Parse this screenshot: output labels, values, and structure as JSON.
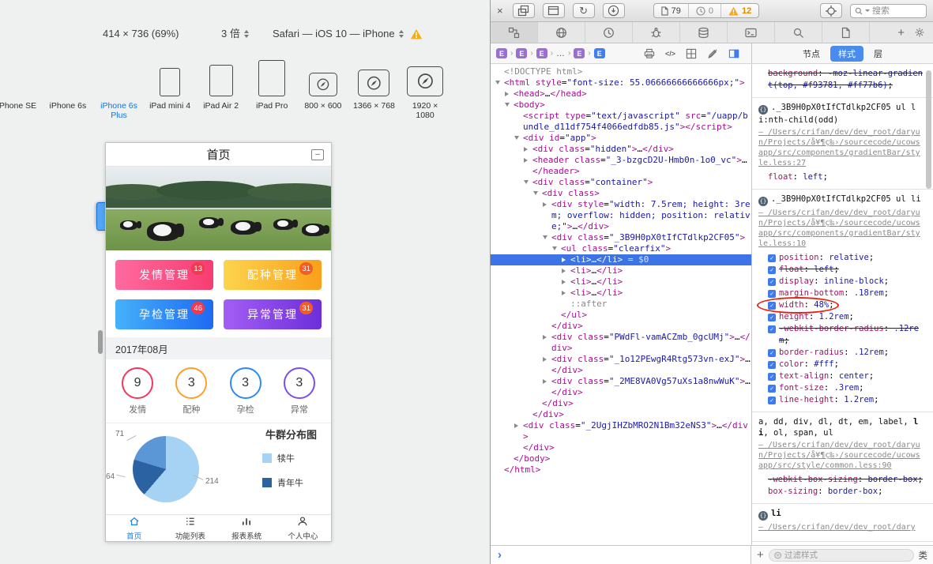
{
  "simulator": {
    "resolution": "414 × 736 (69%)",
    "scale": "3 倍",
    "browser": "Safari — iOS 10 — iPhone",
    "devices": [
      {
        "label": "iPhone SE",
        "type": "phone",
        "size": "s",
        "selected": false
      },
      {
        "label": "iPhone 6s",
        "type": "phone",
        "size": "m",
        "selected": false
      },
      {
        "label": "iPhone 6s Plus",
        "type": "phone",
        "size": "l",
        "selected": true
      },
      {
        "label": "iPad mini 4",
        "type": "tablet",
        "size": "s",
        "selected": false
      },
      {
        "label": "iPad Air 2",
        "type": "tablet",
        "size": "m",
        "selected": false
      },
      {
        "label": "iPad Pro",
        "type": "tablet",
        "size": "l",
        "selected": false
      },
      {
        "label": "800 × 600",
        "type": "browser",
        "size": "s",
        "selected": false
      },
      {
        "label": "1366 × 768",
        "type": "browser",
        "size": "m",
        "selected": false
      },
      {
        "label": "1920 × 1080",
        "type": "browser",
        "size": "l",
        "selected": false
      }
    ]
  },
  "phone": {
    "title": "首页",
    "collapse_glyph": "–",
    "buttons": [
      {
        "label": "发情管理",
        "badge": "13",
        "from": "#ff6a9e",
        "to": "#f73d72",
        "badge_color": "#f03a4f"
      },
      {
        "label": "配种管理",
        "badge": "31",
        "from": "#fdd44d",
        "to": "#f9a01b",
        "badge_color": "#f55b23"
      },
      {
        "label": "孕检管理",
        "badge": "46",
        "from": "#45b1fa",
        "to": "#1e6af2",
        "badge_color": "#f03a4f"
      },
      {
        "label": "异常管理",
        "badge": "31",
        "from": "#a35ef5",
        "to": "#6c2fd9",
        "badge_color": "#f55b23"
      }
    ],
    "month": "2017年08月",
    "stats": [
      {
        "value": "9",
        "label": "发情",
        "color": "#f5365c"
      },
      {
        "value": "3",
        "label": "配种",
        "color": "#fba02b"
      },
      {
        "value": "3",
        "label": "孕检",
        "color": "#2b8af5"
      },
      {
        "value": "3",
        "label": "异常",
        "color": "#7b4df0"
      }
    ],
    "chart_data": {
      "type": "pie",
      "title": "牛群分布图",
      "slices": [
        {
          "label": "犊牛",
          "value": 214,
          "color": "#a6d2f3"
        },
        {
          "label": "青年牛",
          "value": 64,
          "color": "#2a62a2"
        },
        {
          "label": "",
          "value": 71,
          "color": "#5b97d6"
        }
      ],
      "legend": [
        {
          "label": "犊牛",
          "color": "#a6d2f3"
        },
        {
          "label": "青年牛",
          "color": "#2a62a2"
        }
      ]
    },
    "tabbar": [
      {
        "label": "首页",
        "icon": "home",
        "active": true
      },
      {
        "label": "功能列表",
        "icon": "list",
        "active": false
      },
      {
        "label": "报表系统",
        "icon": "chart",
        "active": false
      },
      {
        "label": "个人中心",
        "icon": "user",
        "active": false
      }
    ]
  },
  "inspector": {
    "toolbar": {
      "close_glyph": "×",
      "reload_glyph": "↻",
      "doc_count": "79",
      "time_count": "0",
      "warn_count": "12",
      "search_placeholder": "搜索"
    },
    "breadcrumbs": [
      {
        "label": "E",
        "variant": "purple"
      },
      {
        "label": "E",
        "variant": "purple"
      },
      {
        "label": "E",
        "variant": "purple"
      },
      {
        "label": "…",
        "variant": "plain"
      },
      {
        "label": "E",
        "variant": "purple"
      },
      {
        "label": "E",
        "variant": "blue"
      }
    ],
    "code_glyph": "</>",
    "selected_suffix": "= $0",
    "dom": [
      {
        "i": 0,
        "a": 0,
        "t": [
          [
            "g",
            "<!DOCTYPE html>"
          ]
        ]
      },
      {
        "i": 0,
        "a": 2,
        "t": [
          [
            "t",
            "<html "
          ],
          [
            "t",
            "style"
          ],
          [
            "p",
            "="
          ],
          [
            "v",
            "\"font-size: 55.06666666666666px;\""
          ],
          [
            "t",
            ">"
          ]
        ]
      },
      {
        "i": 1,
        "a": 1,
        "t": [
          [
            "t",
            "<head>"
          ],
          [
            "p",
            "…"
          ],
          [
            "t",
            "</head>"
          ]
        ]
      },
      {
        "i": 1,
        "a": 2,
        "t": [
          [
            "t",
            "<body>"
          ]
        ]
      },
      {
        "i": 2,
        "a": 0,
        "t": [
          [
            "t",
            "<script "
          ],
          [
            "t",
            "type"
          ],
          [
            "p",
            "="
          ],
          [
            "v",
            "\"text/javascript\""
          ],
          [
            "t",
            " src"
          ],
          [
            "p",
            "="
          ],
          [
            "v",
            "\"/uapp/bundle_d11df754f4066edfdb85.js\""
          ],
          [
            "t",
            "></script>"
          ]
        ]
      },
      {
        "i": 2,
        "a": 2,
        "t": [
          [
            "t",
            "<div "
          ],
          [
            "t",
            "id"
          ],
          [
            "p",
            "="
          ],
          [
            "v",
            "\"app\""
          ],
          [
            "t",
            ">"
          ]
        ]
      },
      {
        "i": 3,
        "a": 1,
        "t": [
          [
            "t",
            "<div "
          ],
          [
            "t",
            "class"
          ],
          [
            "p",
            "="
          ],
          [
            "v",
            "\"hidden\""
          ],
          [
            "t",
            ">"
          ],
          [
            "p",
            "…"
          ],
          [
            "t",
            "</div>"
          ]
        ]
      },
      {
        "i": 3,
        "a": 1,
        "t": [
          [
            "t",
            "<header "
          ],
          [
            "t",
            "class"
          ],
          [
            "p",
            "="
          ],
          [
            "v",
            "\"_3-bzgcD2U-Hmb0n-1o0_vc\""
          ],
          [
            "t",
            ">"
          ],
          [
            "p",
            "…"
          ],
          [
            "t",
            "</header>"
          ]
        ]
      },
      {
        "i": 3,
        "a": 2,
        "t": [
          [
            "t",
            "<div "
          ],
          [
            "t",
            "class"
          ],
          [
            "p",
            "="
          ],
          [
            "v",
            "\"container\""
          ],
          [
            "t",
            ">"
          ]
        ]
      },
      {
        "i": 4,
        "a": 2,
        "t": [
          [
            "t",
            "<div "
          ],
          [
            "t",
            "class"
          ],
          [
            "t",
            ">"
          ]
        ]
      },
      {
        "i": 5,
        "a": 1,
        "t": [
          [
            "t",
            "<div "
          ],
          [
            "t",
            "style"
          ],
          [
            "p",
            "="
          ],
          [
            "v",
            "\"width: 7.5rem; height: 3rem; overflow: hidden; position: relative;\""
          ],
          [
            "t",
            ">"
          ],
          [
            "p",
            "…"
          ],
          [
            "t",
            "</div>"
          ]
        ]
      },
      {
        "i": 5,
        "a": 2,
        "t": [
          [
            "t",
            "<div "
          ],
          [
            "t",
            "class"
          ],
          [
            "p",
            "="
          ],
          [
            "v",
            "\"_3B9H0pX0tIfCTdlkp2CF05\""
          ],
          [
            "t",
            ">"
          ]
        ]
      },
      {
        "i": 6,
        "a": 2,
        "t": [
          [
            "t",
            "<ul "
          ],
          [
            "t",
            "class"
          ],
          [
            "p",
            "="
          ],
          [
            "v",
            "\"clearfix\""
          ],
          [
            "t",
            ">"
          ]
        ]
      },
      {
        "i": 7,
        "a": 1,
        "s": 1,
        "t": [
          [
            "t",
            "<li>"
          ],
          [
            "p",
            "…"
          ],
          [
            "t",
            "</li>"
          ]
        ]
      },
      {
        "i": 7,
        "a": 1,
        "t": [
          [
            "t",
            "<li>"
          ],
          [
            "p",
            "…"
          ],
          [
            "t",
            "</li>"
          ]
        ]
      },
      {
        "i": 7,
        "a": 1,
        "t": [
          [
            "t",
            "<li>"
          ],
          [
            "p",
            "…"
          ],
          [
            "t",
            "</li>"
          ]
        ]
      },
      {
        "i": 7,
        "a": 1,
        "t": [
          [
            "t",
            "<li>"
          ],
          [
            "p",
            "…"
          ],
          [
            "t",
            "</li>"
          ]
        ]
      },
      {
        "i": 7,
        "a": 0,
        "t": [
          [
            "g",
            "::after"
          ]
        ]
      },
      {
        "i": 6,
        "a": 0,
        "t": [
          [
            "t",
            "</ul>"
          ]
        ]
      },
      {
        "i": 5,
        "a": 0,
        "t": [
          [
            "t",
            "</div>"
          ]
        ]
      },
      {
        "i": 5,
        "a": 1,
        "t": [
          [
            "t",
            "<div "
          ],
          [
            "t",
            "class"
          ],
          [
            "p",
            "="
          ],
          [
            "v",
            "\"PWdFl-vamACZmb_0gcUMj\""
          ],
          [
            "t",
            ">"
          ],
          [
            "p",
            "…"
          ],
          [
            "t",
            "</div>"
          ]
        ]
      },
      {
        "i": 5,
        "a": 1,
        "t": [
          [
            "t",
            "<div "
          ],
          [
            "t",
            "class"
          ],
          [
            "p",
            "="
          ],
          [
            "v",
            "\"_1o12PEwgR4Rtg573vn-exJ\""
          ],
          [
            "t",
            ">"
          ],
          [
            "p",
            "…"
          ],
          [
            "t",
            "</div>"
          ]
        ]
      },
      {
        "i": 5,
        "a": 1,
        "t": [
          [
            "t",
            "<div "
          ],
          [
            "t",
            "class"
          ],
          [
            "p",
            "="
          ],
          [
            "v",
            "\"_2ME8VA0Vg57uXs1a8nwWuK\""
          ],
          [
            "t",
            ">"
          ],
          [
            "p",
            "…"
          ],
          [
            "t",
            "</div>"
          ]
        ]
      },
      {
        "i": 4,
        "a": 0,
        "t": [
          [
            "t",
            "</div>"
          ]
        ]
      },
      {
        "i": 3,
        "a": 0,
        "t": [
          [
            "t",
            "</div>"
          ]
        ]
      },
      {
        "i": 2,
        "a": 1,
        "t": [
          [
            "t",
            "<div "
          ],
          [
            "t",
            "class"
          ],
          [
            "p",
            "="
          ],
          [
            "v",
            "\"_2UgjIHZbMRO2N1Bm32eNS3\""
          ],
          [
            "t",
            ">"
          ],
          [
            "p",
            "…"
          ],
          [
            "t",
            "</div>"
          ]
        ]
      },
      {
        "i": 2,
        "a": 0,
        "t": [
          [
            "t",
            "</div>"
          ]
        ]
      },
      {
        "i": 1,
        "a": 0,
        "t": [
          [
            "t",
            "</body>"
          ]
        ]
      },
      {
        "i": 0,
        "a": 0,
        "t": [
          [
            "t",
            "</html>"
          ]
        ]
      }
    ],
    "styles": {
      "tabs": [
        "节点",
        "样式",
        "层"
      ],
      "active_tab": "样式",
      "filter_placeholder": "过滤样式",
      "class_button": "类",
      "rules": [
        {
          "icon": false,
          "props": [
            {
              "name": "background",
              "value": "-moz-linear-gradient(top, #f93781, #ff77b6)",
              "struck": true
            }
          ]
        },
        {
          "icon": true,
          "selector_parts": [
            [
              "",
              "._3B9H0pX0tIfCTdlkp2CF05 ul li:nth-child(odd)"
            ]
          ],
          "source": "— /Users/crifan/dev/dev_root/daryun/Projects/å¥¶ç‰›/sourcecode/ucowsapp/src/components/gradientBar/style.less:27",
          "props": [
            {
              "name": "float",
              "value": "left"
            }
          ]
        },
        {
          "icon": true,
          "selector_parts": [
            [
              "",
              "._3B9H0pX0tIfCTdlkp2CF05 ul li"
            ]
          ],
          "source": "— /Users/crifan/dev/dev_root/daryun/Projects/å¥¶ç‰›/sourcecode/ucowsapp/src/components/gradientBar/style.less:10",
          "props": [
            {
              "name": "position",
              "value": "relative",
              "check": true
            },
            {
              "name": "float",
              "value": "left",
              "check": true,
              "struck": true
            },
            {
              "name": "display",
              "value": "inline-block",
              "check": true
            },
            {
              "name": "margin-bottom",
              "value": ".18rem",
              "check": true
            },
            {
              "name": "width",
              "value": "48%",
              "check": true,
              "annotated": true
            },
            {
              "name": "height",
              "value": "1.2rem",
              "check": true
            },
            {
              "name": "-webkit-border-radius",
              "value": ".12rem",
              "check": true,
              "struck": true
            },
            {
              "name": "border-radius",
              "value": ".12rem",
              "check": true
            },
            {
              "name": "color",
              "value": "#fff",
              "check": true
            },
            {
              "name": "text-align",
              "value": "center",
              "check": true
            },
            {
              "name": "font-size",
              "value": ".3rem",
              "check": true
            },
            {
              "name": "line-height",
              "value": "1.2rem",
              "check": true
            }
          ]
        },
        {
          "icon": false,
          "selector_parts": [
            [
              "",
              "a, dd, div, dl, dt, em, label, "
            ],
            [
              "b",
              "li"
            ],
            [
              "",
              ", ol, span, ul"
            ]
          ],
          "source": "— /Users/crifan/dev/dev_root/daryun/Projects/å¥¶ç‰›/sourcecode/ucowsapp/src/style/common.less:90",
          "props": [
            {
              "name": "-webkit-box-sizing",
              "value": "border-box",
              "struck": true
            },
            {
              "name": "box-sizing",
              "value": "border-box"
            }
          ]
        },
        {
          "icon": true,
          "selector_parts": [
            [
              "b",
              "li"
            ]
          ],
          "source": "— /Users/crifan/dev/dev_root/dary",
          "props": []
        }
      ]
    }
  }
}
